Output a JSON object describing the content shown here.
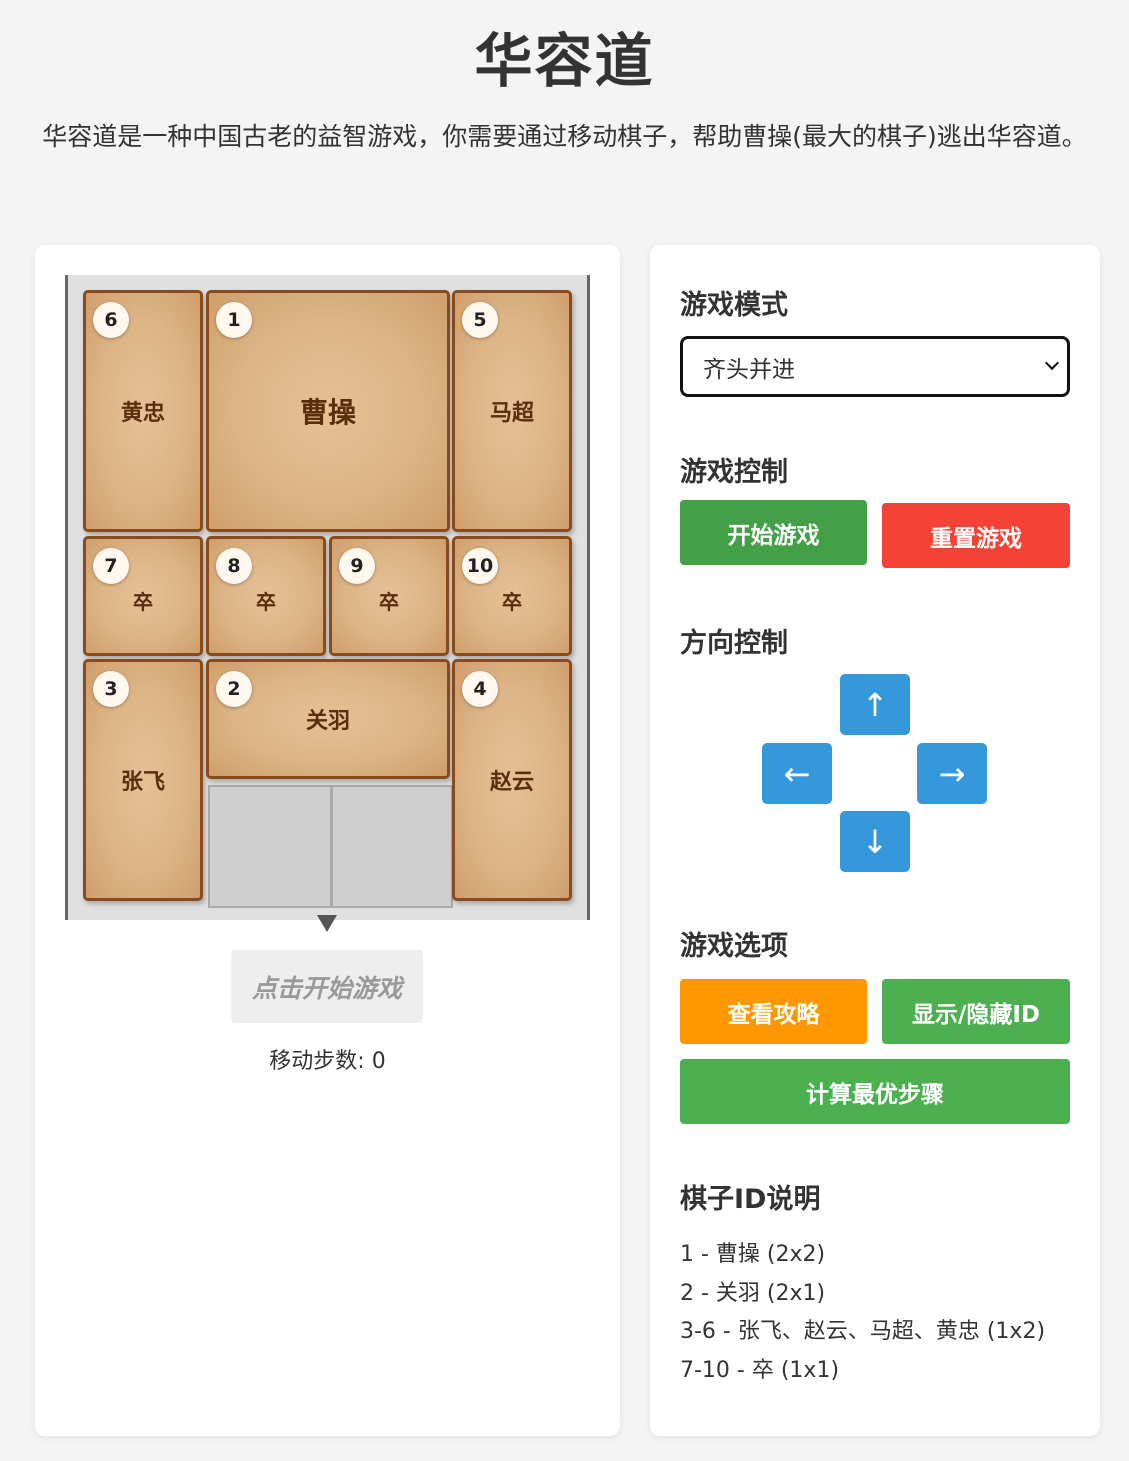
{
  "page": {
    "title": "华容道",
    "intro": "华容道是一种中国古老的益智游戏，你需要通过移动棋子，帮助曹操(最大的棋子)逃出华容道。"
  },
  "board": {
    "pieces": [
      {
        "id": "6",
        "name": "黄忠"
      },
      {
        "id": "1",
        "name": "曹操"
      },
      {
        "id": "5",
        "name": "马超"
      },
      {
        "id": "7",
        "name": "卒"
      },
      {
        "id": "8",
        "name": "卒"
      },
      {
        "id": "9",
        "name": "卒"
      },
      {
        "id": "10",
        "name": "卒"
      },
      {
        "id": "3",
        "name": "张飞"
      },
      {
        "id": "2",
        "name": "关羽"
      },
      {
        "id": "4",
        "name": "赵云"
      }
    ],
    "start_hint": "点击开始游戏",
    "moves_label": "移动步数: 0"
  },
  "panel": {
    "mode_heading": "游戏模式",
    "mode_selected": "齐头并进",
    "control_heading": "游戏控制",
    "start_button": "开始游戏",
    "reset_button": "重置游戏",
    "direction_heading": "方向控制",
    "dir_up": "↑",
    "dir_left": "←",
    "dir_right": "→",
    "dir_down": "↓",
    "options_heading": "游戏选项",
    "guide_button": "查看攻略",
    "toggle_id_button": "显示/隐藏ID",
    "solve_button": "计算最优步骤",
    "legend_heading": "棋子ID说明",
    "legend": [
      "1 - 曹操 (2x2)",
      "2 - 关羽 (2x1)",
      "3-6 - 张飞、赵云、马超、黄忠 (1x2)",
      "7-10 - 卒 (1x1)"
    ]
  },
  "colors": {
    "start": "#43a047",
    "reset": "#f44336",
    "guide": "#ff9800",
    "toggle": "#4caf50",
    "solve": "#4caf50",
    "direction": "#3498db",
    "piece_border": "#8b4a1a"
  }
}
